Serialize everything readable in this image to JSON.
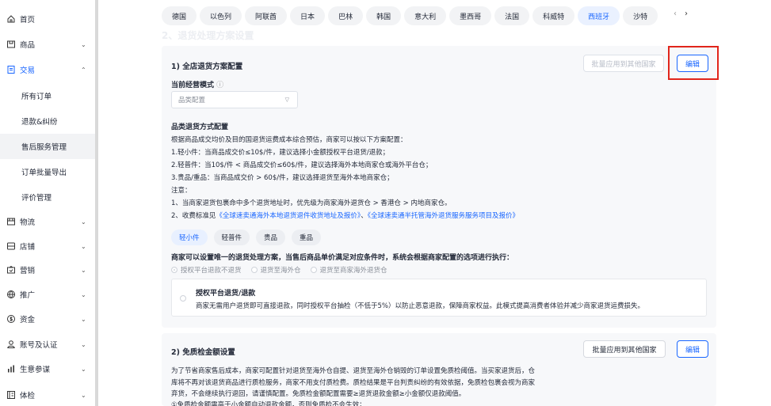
{
  "sidebar": {
    "items": [
      {
        "label": "首页",
        "icon": "home-icon"
      },
      {
        "label": "商品",
        "icon": "product-icon"
      },
      {
        "label": "交易",
        "icon": "trade-icon"
      },
      {
        "label": "物流",
        "icon": "logistics-icon"
      },
      {
        "label": "店铺",
        "icon": "store-icon"
      },
      {
        "label": "营销",
        "icon": "marketing-icon"
      },
      {
        "label": "推广",
        "icon": "promotion-icon"
      },
      {
        "label": "资金",
        "icon": "funds-icon"
      },
      {
        "label": "账号及认证",
        "icon": "account-icon"
      },
      {
        "label": "生意参谋",
        "icon": "analytics-icon"
      },
      {
        "label": "体检",
        "icon": "checkup-icon"
      }
    ],
    "sub_items": [
      "所有订单",
      "退款&纠纷",
      "售后服务管理",
      "订单批量导出",
      "评价管理"
    ]
  },
  "countries": [
    "德国",
    "以色列",
    "阿联酋",
    "日本",
    "巴林",
    "韩国",
    "意大利",
    "墨西哥",
    "法国",
    "科威特",
    "西班牙",
    "沙特"
  ],
  "country_active": "西班牙",
  "section_heading": "2、退货处理方案设置",
  "card1": {
    "title": "1) 全店退货方案配置",
    "bulk_apply": "批量应用到其他国家",
    "edit": "编辑",
    "mode_label": "当前经营模式",
    "mode_value": "品类配置",
    "category_title": "品类退货方式配置",
    "lines": [
      "根据商品成交均价及目的国退货运费成本综合预估，商家可以按以下方案配置：",
      "1.轻小件：当商品成交价≤10$/件，建议选择小金额授权平台退货/退款；",
      "2.轻普件：当10$/件 < 商品成交价≤60$/件，建议选择海外本地商家仓或海外平台仓；",
      "3.贵品/重品：当商品成交价 > 60$/件，建议选择退货至海外本地商家仓；",
      "注意：",
      "1、当商家退货包裹命中多个退货地址时，优先级为商家海外退货仓 > 香港仓 > 内地商家仓。"
    ],
    "note2_prefix": "2、收费标准见",
    "note2_link1": "《全球速卖通海外本地退货退件收货地址及报价》",
    "note2_sep": "、",
    "note2_link2": "《全球速卖通半托管海外退货服务服务项目及报价》",
    "tiers": [
      "轻小件",
      "轻普件",
      "贵品",
      "重品"
    ],
    "rule_text": "商家可以设置唯一的退货处理方案，当售后商品单价满足对应条件时，系统会根据商家配置的选项进行执行：",
    "radios": [
      "授权平台退款不退货",
      "退货至海外仓",
      "退货至商家海外退货仓"
    ],
    "option_title": "授权平台退货/退款",
    "option_desc": "商家无需用户退货即可直接退款，同时授权平台抽检（不低于5%）以防止恶意退款，保障商家权益。此模式提高消费者体验并减少商家退货运费损失。"
  },
  "card2": {
    "title": "2) 免质检金额设置",
    "bulk_apply": "批量应用到其他国家",
    "edit": "编辑",
    "lines": [
      "为了节省商家售后成本，商家可配置针对退货至海外仓自提、退货至海外仓销毁的订单设置免质检阈值。当买家退货后，仓",
      "库将不再对该退货商品进行质检服务，商家不用支付质检费。质检结果是平台判责纠纷的有效依据，免质检包裹会视为商家",
      "弃货，不会继续执行退回，请谨慎配置。免质检金额配置需要≥退货退款金额≥小金额仅退款阈值。",
      "①免质检金额需高于小金额自动退款金额，否则免质检不会生效；"
    ]
  }
}
